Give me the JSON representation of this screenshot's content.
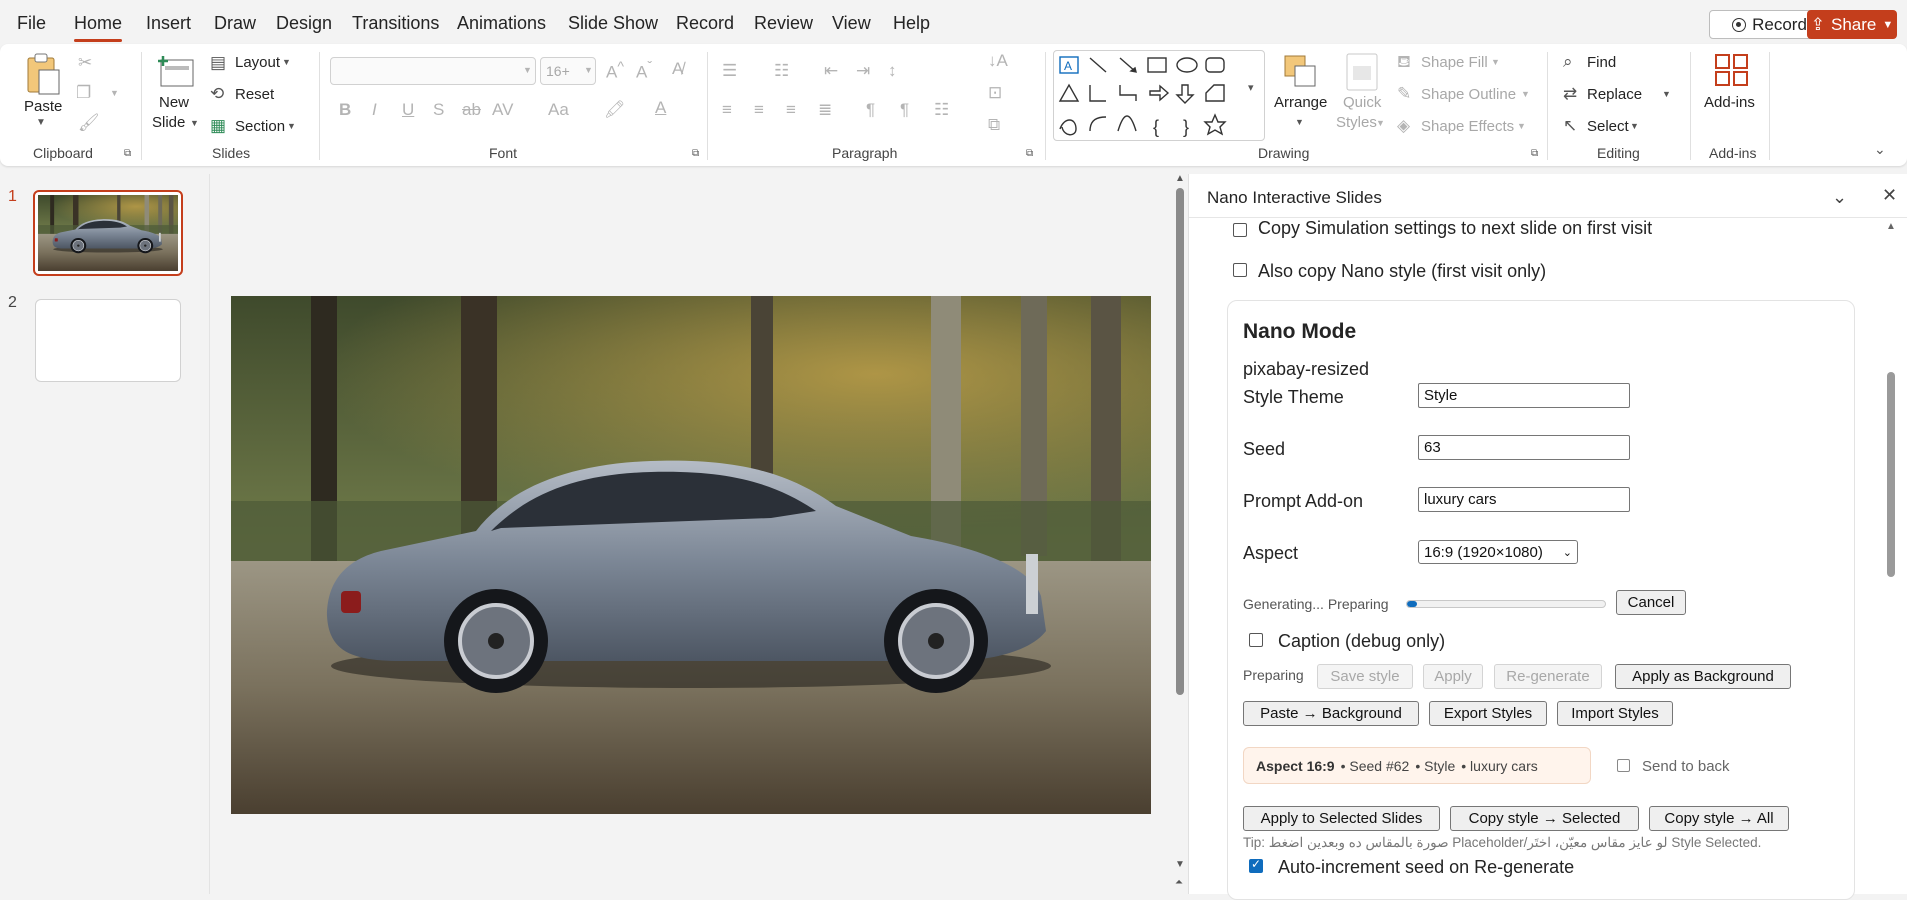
{
  "menu": {
    "tabs": [
      "File",
      "Home",
      "Insert",
      "Draw",
      "Design",
      "Transitions",
      "Animations",
      "Slide Show",
      "Record",
      "Review",
      "View",
      "Help"
    ],
    "active": "Home",
    "record_label": "Record",
    "share_label": "Share",
    "accent_color": "#c43e1c"
  },
  "ribbon": {
    "clipboard": {
      "paste": "Paste",
      "label": "Clipboard"
    },
    "slides": {
      "new_slide_1": "New",
      "new_slide_2": "Slide",
      "layout": "Layout",
      "reset": "Reset",
      "section": "Section",
      "label": "Slides"
    },
    "font": {
      "font_name": "",
      "font_size": "16+",
      "label": "Font"
    },
    "paragraph": {
      "label": "Paragraph"
    },
    "drawing": {
      "arrange": "Arrange",
      "quick_styles_1": "Quick",
      "quick_styles_2": "Styles",
      "shape_fill": "Shape Fill",
      "shape_outline": "Shape Outline",
      "shape_effects": "Shape Effects",
      "label": "Drawing"
    },
    "editing": {
      "find": "Find",
      "replace": "Replace",
      "select": "Select",
      "label": "Editing"
    },
    "addins": {
      "addins": "Add-ins",
      "label": "Add-ins"
    }
  },
  "slides": {
    "items": [
      {
        "number": "1",
        "selected": true
      },
      {
        "number": "2",
        "selected": false
      }
    ]
  },
  "taskpane": {
    "title": "Nano Interactive Slides",
    "copy_sim": "Copy Simulation settings to next slide on first visit",
    "copy_sim_checked": false,
    "copy_style": "Also copy Nano style (first visit only)",
    "copy_style_checked": false,
    "nano": {
      "heading": "Nano Mode",
      "theme_name": "pixabay-resized",
      "style_theme_label": "Style Theme",
      "style_theme_value": "Style",
      "seed_label": "Seed",
      "seed_value": "63",
      "prompt_label": "Prompt Add-on",
      "prompt_value": "luxury cars",
      "aspect_label": "Aspect",
      "aspect_value": "16:9 (1920×1080)",
      "status_text": "Generating... Preparing",
      "progress": 0.05,
      "cancel": "Cancel",
      "caption_label": "Caption (debug only)",
      "caption_checked": false,
      "preparing": "Preparing",
      "save_style": "Save style",
      "apply": "Apply",
      "regenerate": "Re-generate",
      "apply_bg": "Apply as Background",
      "paste_bg": "Paste → Background",
      "export_styles": "Export Styles",
      "import_styles": "Import Styles",
      "summary_aspect": "Aspect 16:9",
      "summary_seed": "• Seed #62",
      "summary_style": "• Style",
      "summary_prompt": "• luxury cars",
      "send_back": "Send to back",
      "send_back_checked": false,
      "apply_selected": "Apply to Selected Slides",
      "copy_selected": "Copy style → Selected",
      "copy_all": "Copy style → All",
      "tip": "Tip: صورة بالمقاس ده وبعدين اضغط Placeholder/لو عايز مقاس معيّن، اختَر Style Selected.",
      "autoinc": "Auto-increment seed on Re-generate",
      "autoinc_checked": true
    }
  }
}
